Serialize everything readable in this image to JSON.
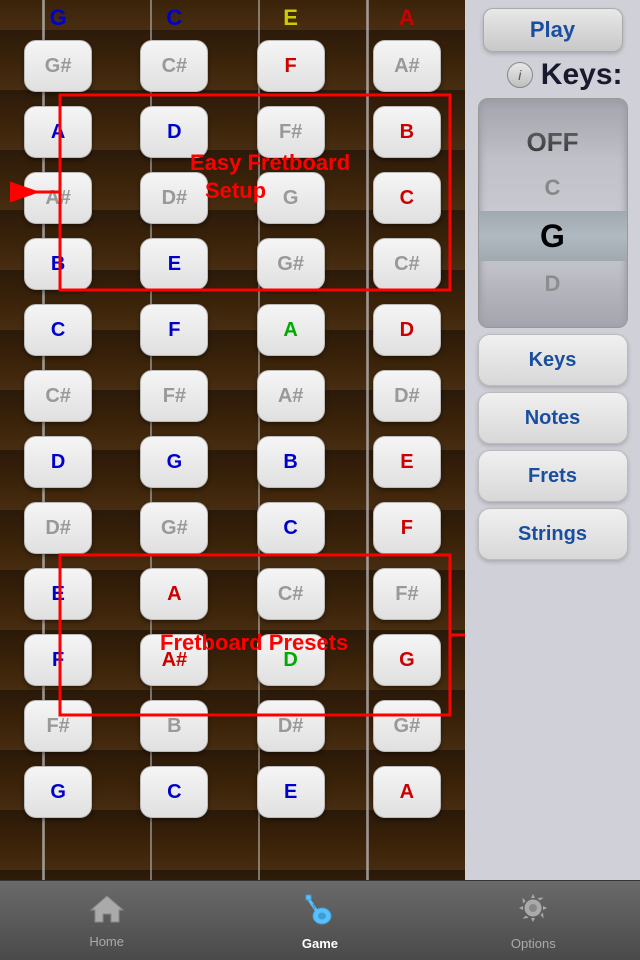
{
  "fretboard": {
    "open_strings": [
      {
        "label": "G",
        "color": "blue"
      },
      {
        "label": "C",
        "color": "blue"
      },
      {
        "label": "E",
        "color": "yellow"
      },
      {
        "label": "A",
        "color": "red"
      }
    ],
    "rows": [
      {
        "gray": [
          "G#",
          "C#",
          "",
          "A#"
        ],
        "notes": []
      },
      {
        "colored": [
          {
            "label": "A",
            "color": "blue"
          },
          {
            "label": "D",
            "color": "blue"
          },
          {
            "label": "F#",
            "color": "gray"
          },
          {
            "label": "B",
            "color": "red"
          }
        ]
      },
      {
        "gray": [
          "A#",
          "D#",
          "G",
          "C"
        ]
      },
      {
        "colored": [
          {
            "label": "B",
            "color": "blue"
          },
          {
            "label": "E",
            "color": "blue"
          },
          {
            "label": "G#",
            "color": "gray"
          },
          {
            "label": "C#",
            "color": "gray"
          }
        ]
      },
      {
        "colored": [
          {
            "label": "C",
            "color": "blue"
          },
          {
            "label": "F",
            "color": "blue"
          },
          {
            "label": "A",
            "color": "green"
          },
          {
            "label": "D",
            "color": "red"
          }
        ]
      },
      {
        "gray": [
          "C#",
          "F#",
          "A#",
          "D#"
        ]
      },
      {
        "colored": [
          {
            "label": "D",
            "color": "blue"
          },
          {
            "label": "G",
            "color": "blue"
          },
          {
            "label": "B",
            "color": "blue"
          },
          {
            "label": "E",
            "color": "red"
          }
        ]
      },
      {
        "gray_mid": [
          "D#",
          "G#",
          "C",
          "F"
        ]
      },
      {
        "colored": [
          {
            "label": "E",
            "color": "blue"
          },
          {
            "label": "A",
            "color": "red"
          },
          {
            "label": "C#",
            "color": "gray"
          },
          {
            "label": "F#",
            "color": "gray"
          }
        ]
      },
      {
        "colored": [
          {
            "label": "F",
            "color": "blue"
          },
          {
            "label": "A#",
            "color": "red"
          },
          {
            "label": "D",
            "color": "green"
          },
          {
            "label": "G",
            "color": "red"
          }
        ]
      },
      {
        "gray": [
          "F#",
          "B",
          "D#",
          "G#"
        ]
      },
      {
        "colored": [
          {
            "label": "G",
            "color": "blue"
          },
          {
            "label": "C",
            "color": "blue"
          },
          {
            "label": "E",
            "color": "blue"
          },
          {
            "label": "A",
            "color": "red"
          }
        ]
      }
    ],
    "annotation1": {
      "text": "Easy Fretboard\nSetup",
      "color": "red"
    },
    "annotation2": {
      "text": "Fretboard Presets",
      "color": "red"
    }
  },
  "right_panel": {
    "play_button": "Play",
    "keys_title": "Keys:",
    "info_icon": "i",
    "picker": {
      "items": [
        "OFF",
        "C",
        "G",
        "D"
      ],
      "selected_index": 2
    },
    "buttons": [
      "Keys",
      "Notes",
      "Frets",
      "Strings"
    ]
  },
  "tab_bar": {
    "items": [
      {
        "label": "Home",
        "icon": "home",
        "active": false
      },
      {
        "label": "Game",
        "icon": "guitar",
        "active": true
      },
      {
        "label": "Options",
        "icon": "gear",
        "active": false
      }
    ]
  }
}
